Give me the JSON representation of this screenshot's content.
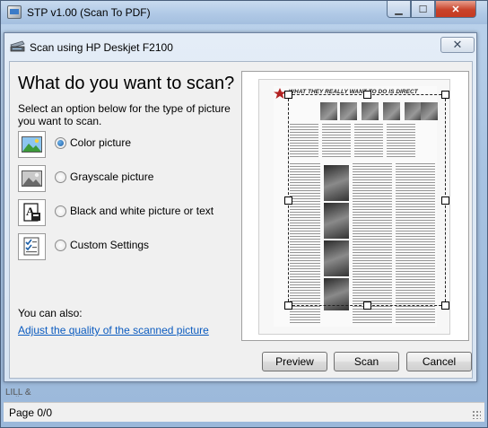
{
  "outer_window": {
    "title": "STP v1.00 (Scan To PDF)",
    "behind_text": "LILL & Lalla",
    "status": "Page 0/0"
  },
  "dialog": {
    "title": "Scan using HP Deskjet F2100",
    "close_symbol": "✕",
    "heading": "What do you want to scan?",
    "instructions": "Select an option below for the type of picture you want to scan.",
    "options": [
      {
        "label": "Color picture",
        "icon": "color-picture-icon",
        "selected": true
      },
      {
        "label": "Grayscale picture",
        "icon": "grayscale-picture-icon",
        "selected": false
      },
      {
        "label": "Black and white picture or text",
        "icon": "bw-picture-text-icon",
        "selected": false
      },
      {
        "label": "Custom Settings",
        "icon": "custom-settings-icon",
        "selected": false
      }
    ],
    "you_can_also": "You can also:",
    "adjust_link": "Adjust the quality of the scanned picture",
    "buttons": {
      "preview": "Preview",
      "scan": "Scan",
      "cancel": "Cancel"
    }
  },
  "preview": {
    "headline": "WHAT THEY REALLY WANT TO DO IS DIRECT"
  },
  "colors": {
    "link": "#0b5bbf",
    "close_red": "#c8432b",
    "radio_selected": "#1c5fa8",
    "magazine_accent": "#b22222"
  }
}
